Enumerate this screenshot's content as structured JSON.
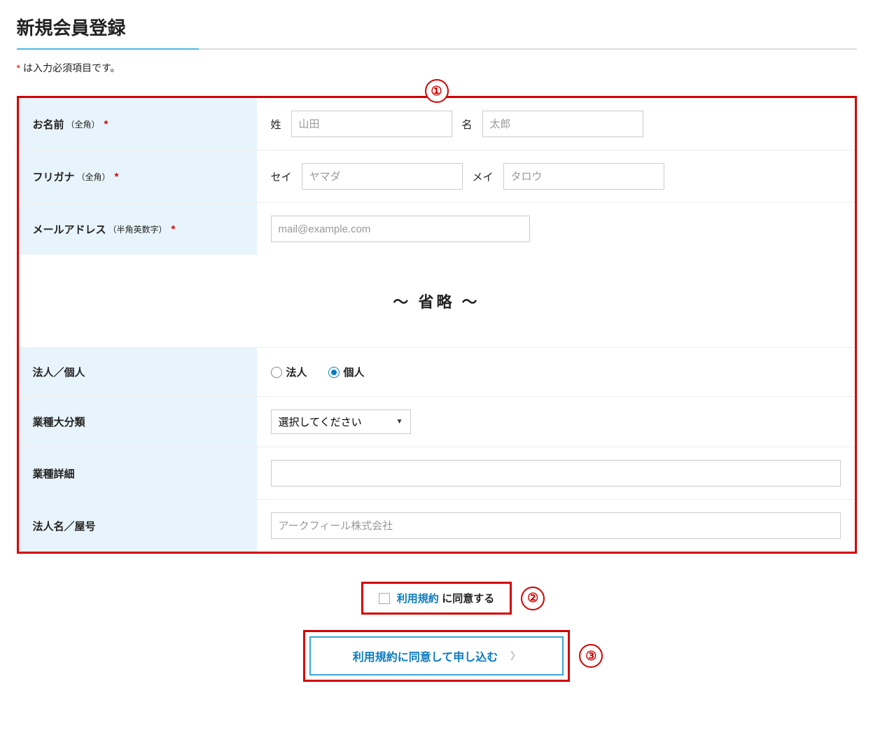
{
  "page": {
    "title": "新規会員登録",
    "required_note_asterisk": "*",
    "required_note_text": "は入力必須項目です。"
  },
  "annotations": {
    "one": "①",
    "two": "②",
    "three": "③"
  },
  "form": {
    "name": {
      "label": "お名前",
      "sub": "（全角）",
      "family_label": "姓",
      "family_placeholder": "山田",
      "given_label": "名",
      "given_placeholder": "太郎"
    },
    "kana": {
      "label": "フリガナ",
      "sub": "（全角）",
      "family_label": "セイ",
      "family_placeholder": "ヤマダ",
      "given_label": "メイ",
      "given_placeholder": "タロウ"
    },
    "email": {
      "label": "メールアドレス",
      "sub": "（半角英数字）",
      "placeholder": "mail@example.com"
    },
    "omitted": "〜 省略 〜",
    "entity": {
      "label": "法人／個人",
      "corporate": "法人",
      "individual": "個人",
      "selected": "individual"
    },
    "category": {
      "label": "業種大分類",
      "placeholder": "選択してください"
    },
    "detail": {
      "label": "業種詳細"
    },
    "company": {
      "label": "法人名／屋号",
      "placeholder": "アークフィール株式会社"
    }
  },
  "agree": {
    "link": "利用規約",
    "text": "に同意する"
  },
  "submit": {
    "label": "利用規約に同意して申し込む"
  }
}
